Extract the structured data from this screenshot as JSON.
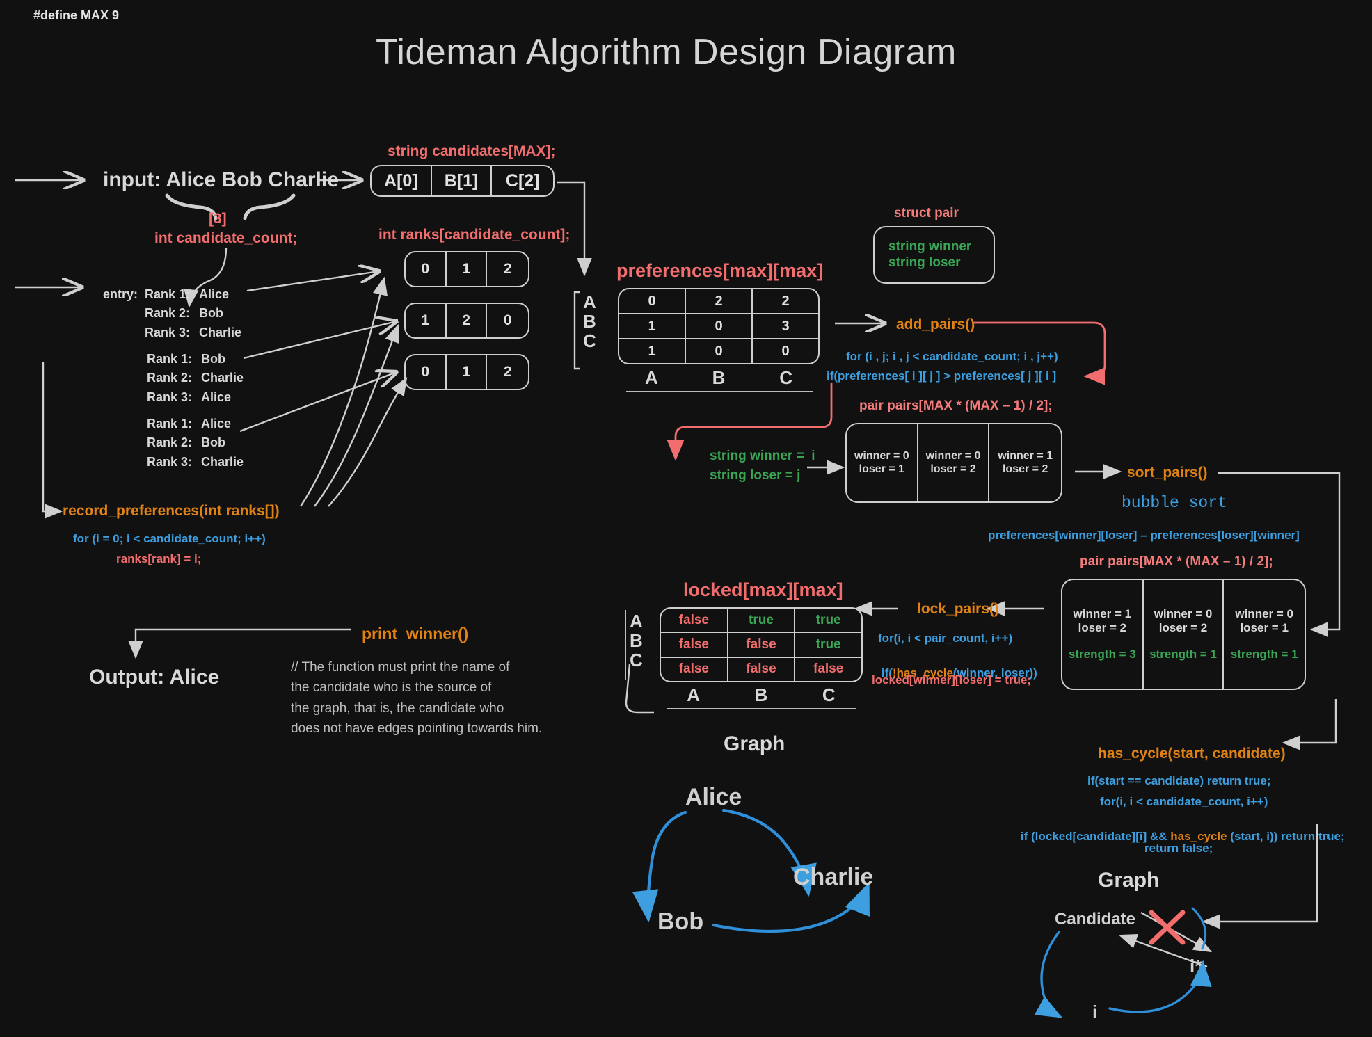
{
  "meta": {
    "define": "#define MAX 9",
    "title": "Tideman Algorithm Design Diagram"
  },
  "input": {
    "label": "input: Alice Bob Charlie",
    "count_value": "[3]",
    "count_decl": "int candidate_count;"
  },
  "candidates_array": {
    "decl": "string candidates[MAX];",
    "cells": [
      "A[0]",
      "B[1]",
      "C[2]"
    ]
  },
  "entries": {
    "entry_label": "entry:",
    "ballots": [
      {
        "rows": [
          {
            "rank": "Rank 1:",
            "name": "Alice"
          },
          {
            "rank": "Rank 2:",
            "name": "Bob"
          },
          {
            "rank": "Rank 3:",
            "name": "Charlie"
          }
        ]
      },
      {
        "rows": [
          {
            "rank": "Rank 1:",
            "name": "Bob"
          },
          {
            "rank": "Rank 2:",
            "name": "Charlie"
          },
          {
            "rank": "Rank 3:",
            "name": "Alice"
          }
        ]
      },
      {
        "rows": [
          {
            "rank": "Rank 1:",
            "name": "Alice"
          },
          {
            "rank": "Rank 2:",
            "name": "Bob"
          },
          {
            "rank": "Rank 3:",
            "name": "Charlie"
          }
        ]
      }
    ]
  },
  "ranks_arrays": {
    "decl": "int ranks[candidate_count];",
    "rows": [
      [
        "0",
        "1",
        "2"
      ],
      [
        "1",
        "2",
        "0"
      ],
      [
        "0",
        "1",
        "2"
      ]
    ]
  },
  "record_preferences": {
    "name": "record_preferences(int ranks[])",
    "line1": "for (i = 0; i < candidate_count; i++)",
    "line2": "ranks[rank] = i;"
  },
  "preferences": {
    "title": "preferences[max][max]",
    "row_labels": [
      "A",
      "B",
      "C"
    ],
    "col_labels": [
      "A",
      "B",
      "C"
    ],
    "values": [
      [
        "0",
        "2",
        "2"
      ],
      [
        "1",
        "0",
        "3"
      ],
      [
        "1",
        "0",
        "0"
      ]
    ]
  },
  "struct_pair": {
    "title": "struct pair",
    "fields": [
      "string winner",
      "string loser"
    ]
  },
  "add_pairs": {
    "name": "add_pairs()",
    "line1": "for (i , j; i , j < candidate_count; i , j++)",
    "line2": "if(preferences[ i ][ j ] > preferences[ j ][ i ]"
  },
  "winner_loser_note": {
    "line1": "string winner =  i",
    "line2": "string loser = j"
  },
  "pairs_array": {
    "decl": "pair pairs[MAX * (MAX – 1) / 2];",
    "cells": [
      {
        "winner": "winner = 0",
        "loser": "loser = 1"
      },
      {
        "winner": "winner = 0",
        "loser": "loser = 2"
      },
      {
        "winner": "winner = 1",
        "loser": "loser = 2"
      }
    ]
  },
  "sort_pairs": {
    "name": "sort_pairs()",
    "method": "bubble sort",
    "formula": "preferences[winner][loser] – preferences[loser][winner]"
  },
  "sorted_pairs_array": {
    "decl": "pair pairs[MAX * (MAX – 1) / 2];",
    "cells": [
      {
        "winner": "winner = 1",
        "loser": "loser = 2",
        "strength": "strength = 3"
      },
      {
        "winner": "winner = 0",
        "loser": "loser = 2",
        "strength": "strength = 1"
      },
      {
        "winner": "winner = 0",
        "loser": "loser = 1",
        "strength": "strength = 1"
      }
    ]
  },
  "lock_pairs": {
    "name": "lock_pairs()",
    "line1": "for(i, i < pair_count, i++)",
    "line2_a": "if(",
    "line2_b": "!has_cycle",
    "line2_c": "(winner, loser))",
    "line3": "locked[winner][loser] = true;"
  },
  "locked": {
    "title": "locked[max][max]",
    "row_labels": [
      "A",
      "B",
      "C"
    ],
    "col_labels": [
      "A",
      "B",
      "C"
    ],
    "values": [
      [
        "false",
        "true",
        "true"
      ],
      [
        "false",
        "false",
        "true"
      ],
      [
        "false",
        "false",
        "false"
      ]
    ]
  },
  "graph_left": {
    "caption": "Graph",
    "nodes": [
      "Alice",
      "Charlie",
      "Bob"
    ]
  },
  "has_cycle": {
    "name": "has_cycle(start, candidate)",
    "line1": "if(start == candidate) return true;",
    "line2": "for(i, i < candidate_count, i++)",
    "line3_a": "if (locked[candidate][i] && ",
    "line3_b": "has_cycle",
    "line3_c": " (start, i)) return true;",
    "line4": "return false;",
    "caption": "Graph",
    "nodes": [
      "Candidate",
      "i*",
      "i"
    ]
  },
  "print_winner": {
    "name": "print_winner()",
    "output": "Output: Alice",
    "comment": "// The function must print the name of\nthe candidate who is the source of\nthe graph, that is, the candidate who\ndoes not have edges pointing towards him."
  },
  "colors": {
    "background": "#111111",
    "red": "#f26d6d",
    "orange": "#e08214",
    "blue": "#3d9fe0",
    "green": "#3aa655",
    "white": "#d9d9d9"
  }
}
